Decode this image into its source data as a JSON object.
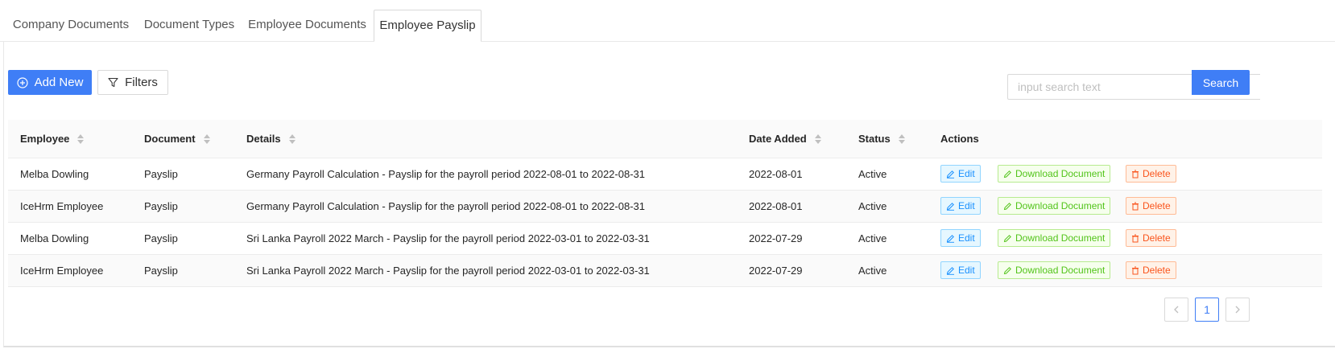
{
  "tabs": [
    {
      "label": "Company Documents"
    },
    {
      "label": "Document Types"
    },
    {
      "label": "Employee Documents"
    },
    {
      "label": "Employee Payslip"
    }
  ],
  "toolbar": {
    "add_new_label": "Add New",
    "filters_label": "Filters",
    "search_placeholder": "input search text",
    "search_button_label": "Search"
  },
  "table": {
    "columns": [
      "Employee",
      "Document",
      "Details",
      "Date Added",
      "Status",
      "Actions"
    ],
    "rows": [
      {
        "employee": "Melba Dowling",
        "document": "Payslip",
        "details": "Germany Payroll Calculation - Payslip for the payroll period 2022-08-01 to 2022-08-31",
        "date_added": "2022-08-01",
        "status": "Active"
      },
      {
        "employee": "IceHrm Employee",
        "document": "Payslip",
        "details": "Germany Payroll Calculation - Payslip for the payroll period 2022-08-01 to 2022-08-31",
        "date_added": "2022-08-01",
        "status": "Active"
      },
      {
        "employee": "Melba Dowling",
        "document": "Payslip",
        "details": "Sri Lanka Payroll 2022 March - Payslip for the payroll period 2022-03-01 to 2022-03-31",
        "date_added": "2022-07-29",
        "status": "Active"
      },
      {
        "employee": "IceHrm Employee",
        "document": "Payslip",
        "details": "Sri Lanka Payroll 2022 March - Payslip for the payroll period 2022-03-01 to 2022-03-31",
        "date_added": "2022-07-29",
        "status": "Active"
      }
    ],
    "actions": {
      "edit": "Edit",
      "download": "Download Document",
      "delete": "Delete"
    }
  },
  "pagination": {
    "current_page": "1"
  },
  "colors": {
    "primary": "#3f7ef6",
    "edit": "#1890ff",
    "download": "#52c41a",
    "delete": "#fa541c"
  },
  "icons": [
    "plus-circle-icon",
    "filter-icon",
    "edit-icon",
    "download-icon",
    "delete-icon",
    "chevron-left-icon",
    "chevron-right-icon",
    "sort-icon"
  ]
}
